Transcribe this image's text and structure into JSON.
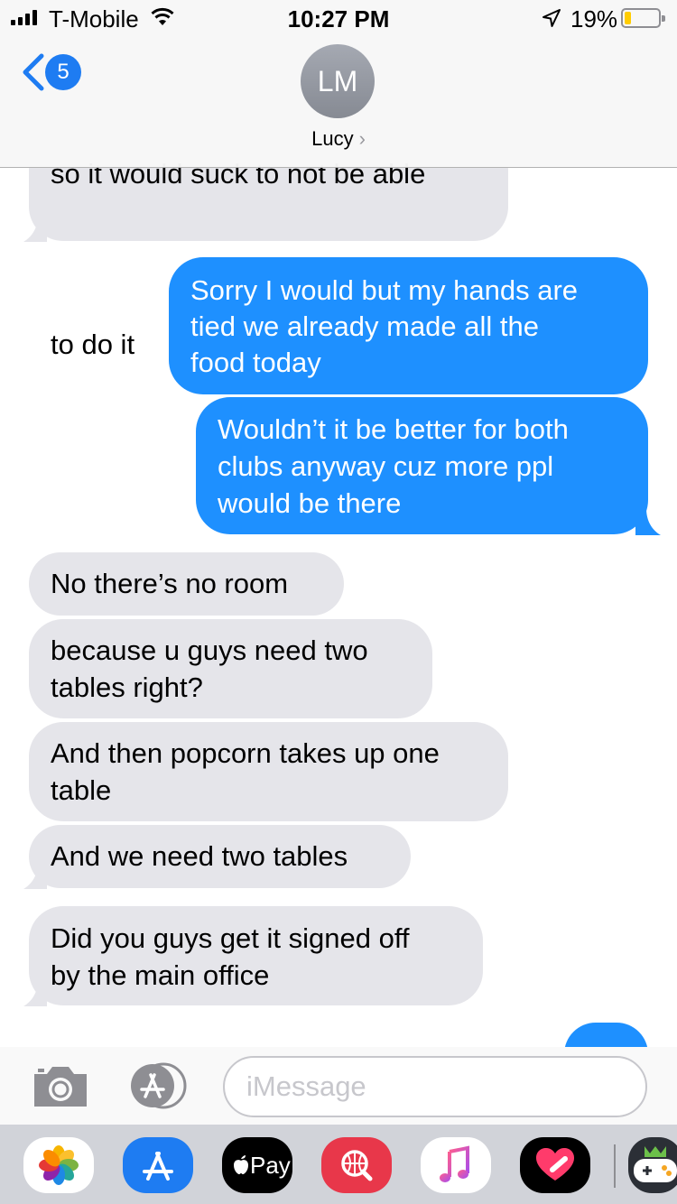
{
  "status_bar": {
    "carrier": "T-Mobile",
    "time": "10:27 PM",
    "battery_percent": "19%",
    "battery_level": 0.19,
    "signal_bars": 4,
    "battery_color": "#ffcc00"
  },
  "header": {
    "back_badge": "5",
    "avatar_initials": "LM",
    "contact_name": "Lucy"
  },
  "messages": [
    {
      "direction": "incoming",
      "text": "so it would suck to not be able"
    },
    {
      "direction": "incoming",
      "text": "to do it"
    },
    {
      "direction": "outgoing",
      "text": "Sorry I would but my hands are"
    },
    {
      "direction": "outgoing",
      "text": "tied we already made all the"
    },
    {
      "direction": "outgoing",
      "text": "food today"
    },
    {
      "direction": "outgoing",
      "text": "Wouldn’t it be better for both"
    },
    {
      "direction": "outgoing",
      "text": "clubs anyway cuz more ppl"
    },
    {
      "direction": "outgoing",
      "text": "would be there"
    },
    {
      "direction": "incoming",
      "text": "No there’s no room"
    },
    {
      "direction": "incoming",
      "text": "because u guys need two"
    },
    {
      "direction": "incoming",
      "text": "tables right?"
    },
    {
      "direction": "incoming",
      "text": "And then popcorn takes up one"
    },
    {
      "direction": "incoming",
      "text": "table"
    },
    {
      "direction": "incoming",
      "text": "And we need two tables"
    },
    {
      "direction": "incoming",
      "text": "Did you guys get it signed off"
    },
    {
      "direction": "incoming",
      "text": "by the main office"
    }
  ],
  "compose": {
    "placeholder": "iMessage"
  },
  "app_drawer": {
    "apple_pay_label": "Pay",
    "apps": [
      "photos-app",
      "app-store-app",
      "apple-pay-app",
      "image-search-app",
      "music-app",
      "digital-touch-app",
      "game-app"
    ]
  },
  "colors": {
    "outgoing_bubble": "#1e90ff",
    "incoming_bubble": "#e5e5ea",
    "accent": "#1e7cf2"
  }
}
